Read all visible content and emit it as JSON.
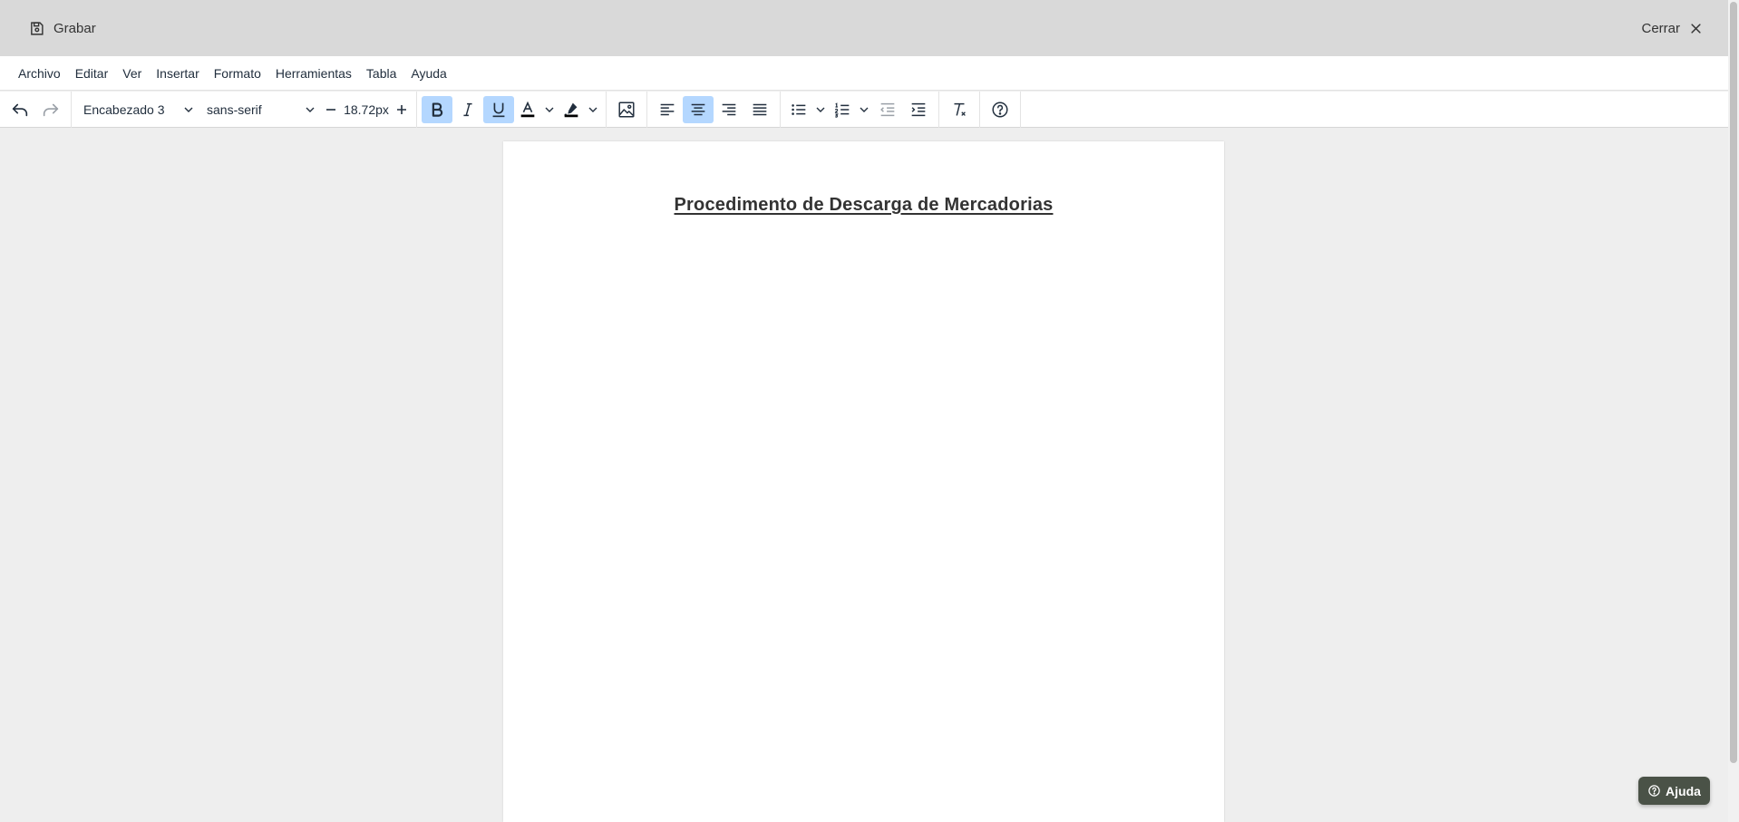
{
  "topbar": {
    "save_label": "Grabar",
    "save_icon": "floppy-disk-icon",
    "close_label": "Cerrar",
    "close_icon": "close-icon"
  },
  "menubar": {
    "items": [
      "Archivo",
      "Editar",
      "Ver",
      "Insertar",
      "Formato",
      "Herramientas",
      "Tabla",
      "Ayuda"
    ]
  },
  "toolbar": {
    "block_format": "Encabezado 3",
    "font_family": "sans-serif",
    "font_size": "18.72px",
    "active_states": {
      "bold": true,
      "italic": false,
      "underline": true,
      "align": "center"
    },
    "icons": [
      "undo-icon",
      "redo-icon",
      "bold-icon",
      "italic-icon",
      "underline-icon",
      "text-color-icon",
      "highlight-icon",
      "image-icon",
      "align-left-icon",
      "align-center-icon",
      "align-right-icon",
      "justify-icon",
      "bullet-list-icon",
      "numbered-list-icon",
      "outdent-icon",
      "indent-icon",
      "clear-formatting-icon",
      "help-icon"
    ],
    "text_color": "#000000",
    "highlight_color": "#000000",
    "active_bg": "#b4d7ff"
  },
  "document": {
    "heading": "Procedimento de Descarga de Mercadorias"
  },
  "help_button": {
    "label": "Ajuda",
    "bg_color": "#4a5247"
  }
}
